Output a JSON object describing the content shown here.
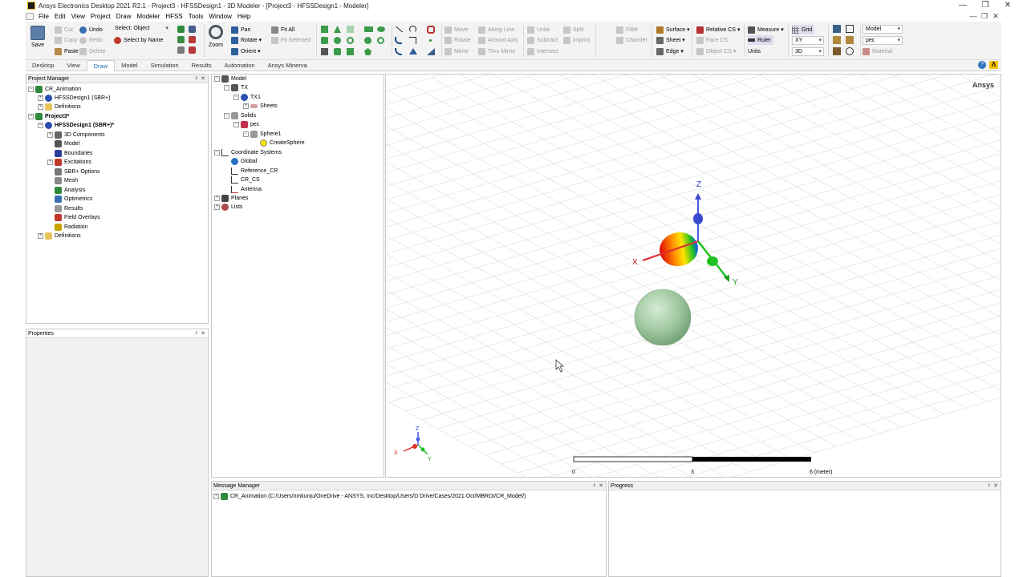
{
  "window": {
    "title": "Ansys Electronics Desktop 2021 R2.1 - Project3 - HFSSDesign1 - 3D Modeler - [Project3 - HFSSDesign1 - Modeler]",
    "controls": [
      "—",
      "❐",
      "✕"
    ]
  },
  "menu": {
    "items": [
      "File",
      "Edit",
      "View",
      "Project",
      "Draw",
      "Modeler",
      "HFSS",
      "Tools",
      "Window",
      "Help"
    ],
    "mdi_controls": [
      "—",
      "❐",
      "✕"
    ]
  },
  "ribbon": {
    "save": "Save",
    "cut": "Cut",
    "copy": "Copy",
    "paste": "Paste",
    "undo": "Undo",
    "redo": "Redo",
    "delete": "Delete",
    "select_label": "Select: Object",
    "select_by_name": "Select by Name",
    "zoom": "Zoom",
    "pan": "Pan",
    "rotate": "Rotate",
    "orient": "Orient",
    "fit_all": "Fit All",
    "fit_selected": "Fit Selected",
    "move": "Move",
    "rotate_op": "Rotate",
    "mirror": "Mirror",
    "along_line": "Along Line",
    "around_axis": "Around Axis",
    "thru_mirror": "Thru Mirror",
    "unite": "Unite",
    "subtract": "Subtract",
    "intersect": "Intersect",
    "split": "Split",
    "imprint": "Imprint",
    "fillet": "Fillet",
    "chamfer": "Chamfer",
    "surface": "Surface",
    "sheet": "Sheet",
    "edge": "Edge",
    "relative_cs": "Relative CS",
    "face_cs": "Face CS",
    "object_cs": "Object CS",
    "measure": "Measure",
    "ruler": "Ruler",
    "units": "Units",
    "grid": "Grid",
    "plane_value": "XY",
    "dim_value": "3D",
    "model_value": "Model",
    "material_value": "pec",
    "material": "Material"
  },
  "tabs": [
    "Desktop",
    "View",
    "Draw",
    "Model",
    "Simulation",
    "Results",
    "Automation",
    "Ansys Minerva"
  ],
  "active_tab": "Draw",
  "project_manager": {
    "title": "Project Manager",
    "rows": [
      {
        "label": "CR_Animation",
        "bold": false
      },
      {
        "label": "HFSSDesign1 (SBR+)",
        "bold": false
      },
      {
        "label": "Definitions",
        "bold": false
      },
      {
        "label": "Project3*",
        "bold": true
      },
      {
        "label": "HFSSDesign1 (SBR+)*",
        "bold": true
      },
      {
        "label": "3D Components",
        "bold": false
      },
      {
        "label": "Model",
        "bold": false
      },
      {
        "label": "Boundaries",
        "bold": false
      },
      {
        "label": "Excitations",
        "bold": false
      },
      {
        "label": "SBR+ Options",
        "bold": false
      },
      {
        "label": "Mesh",
        "bold": false
      },
      {
        "label": "Analysis",
        "bold": false
      },
      {
        "label": "Optimetrics",
        "bold": false
      },
      {
        "label": "Results",
        "bold": false
      },
      {
        "label": "Field Overlays",
        "bold": false
      },
      {
        "label": "Radiation",
        "bold": false
      },
      {
        "label": "Definitions",
        "bold": false
      }
    ]
  },
  "properties": {
    "title": "Properties"
  },
  "model_tree": {
    "rows": [
      "Model",
      "TX",
      "TX1",
      "Sheets",
      "Solids",
      "pec",
      "Sphere1",
      "CreateSphere",
      "Coordinate Systems",
      "Global",
      "Reference_CR",
      "CR_CS",
      "Antenna",
      "Planes",
      "Lists"
    ]
  },
  "viewport": {
    "brand": "Ansys",
    "axis_z": "Z",
    "axis_x": "X",
    "axis_y": "Y",
    "scale_labels": [
      "0",
      "3",
      "6 (meter)"
    ],
    "mini_axes": [
      "Z",
      "X",
      "Y"
    ]
  },
  "message_manager": {
    "title": "Message Manager",
    "entry": "CR_Animation (C:/Users/nmkunju/OneDrive - ANSYS, Inc/Desktop/Users/D Drive/Cases/2021 Oct/MBRDI/CR_Model/)"
  },
  "progress": {
    "title": "Progress"
  },
  "panel_controls": [
    "ᵖ",
    "✕"
  ]
}
